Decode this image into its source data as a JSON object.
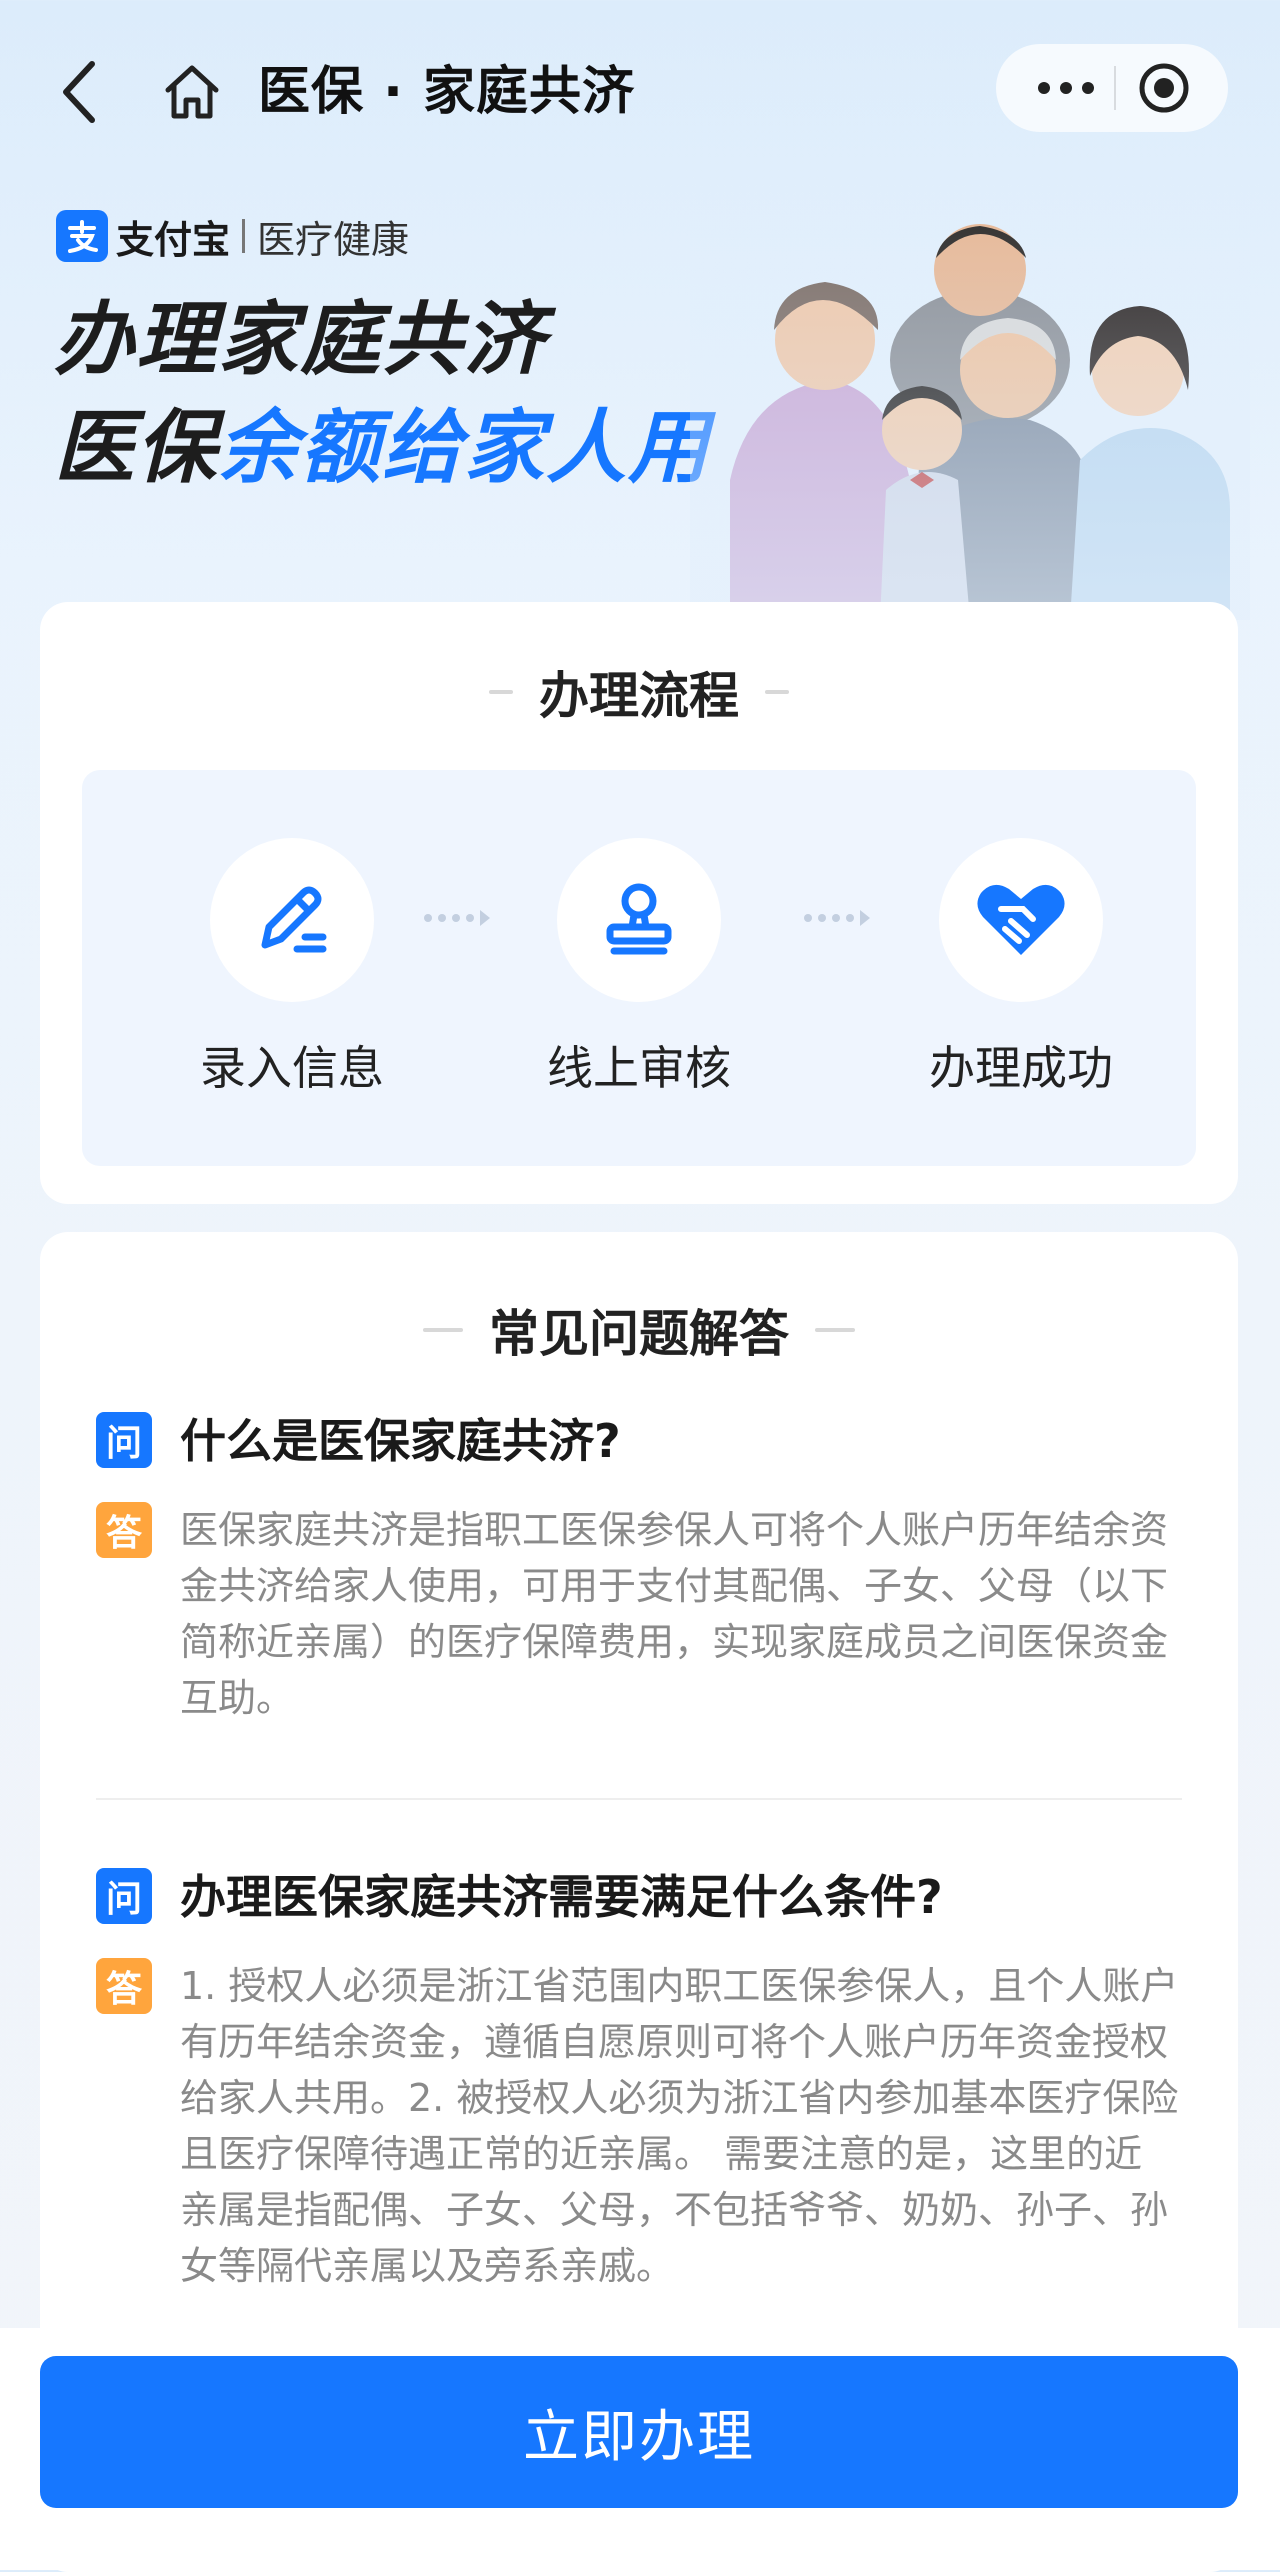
{
  "nav": {
    "title": "医保 · 家庭共济"
  },
  "hero": {
    "brand_name": "支付宝",
    "brand_sub": "医疗健康",
    "headline_line1": "办理家庭共济",
    "headline_line2_prefix": "医保",
    "headline_line2_highlight": "余额给家人用"
  },
  "process": {
    "title": "办理流程",
    "steps": [
      {
        "label": "录入信息",
        "icon": "edit-pen-icon"
      },
      {
        "label": "线上审核",
        "icon": "stamp-icon"
      },
      {
        "label": "办理成功",
        "icon": "heart-handshake-icon"
      }
    ]
  },
  "faq": {
    "title": "常见问题解答",
    "q_tag": "问",
    "a_tag": "答",
    "items": [
      {
        "question": "什么是医保家庭共济?",
        "answer": "医保家庭共济是指职工医保参保人可将个人账户历年结余资金共济给家人使用，可用于支付其配偶、子女、父母（以下简称近亲属）的医疗保障费用，实现家庭成员之间医保资金互助。"
      },
      {
        "question": "办理医保家庭共济需要满足什么条件?",
        "answer": "1. 授权人必须是浙江省范围内职工医保参保人，且个人账户有历年结余资金，遵循自愿原则可将个人账户历年资金授权给家人共用。2. 被授权人必须为浙江省内参加基本医疗保险且医疗保障待遇正常的近亲属。 需要注意的是，这里的近亲属是指配偶、子女、父母，不包括爷爷、奶奶、孙子、孙女等隔代亲属以及旁系亲戚。"
      }
    ]
  },
  "actions": {
    "primary_label": "立即办理"
  },
  "colors": {
    "accent": "#1677ff",
    "answer_tag": "#ffa53d",
    "step_panel": "#eff5fe"
  }
}
